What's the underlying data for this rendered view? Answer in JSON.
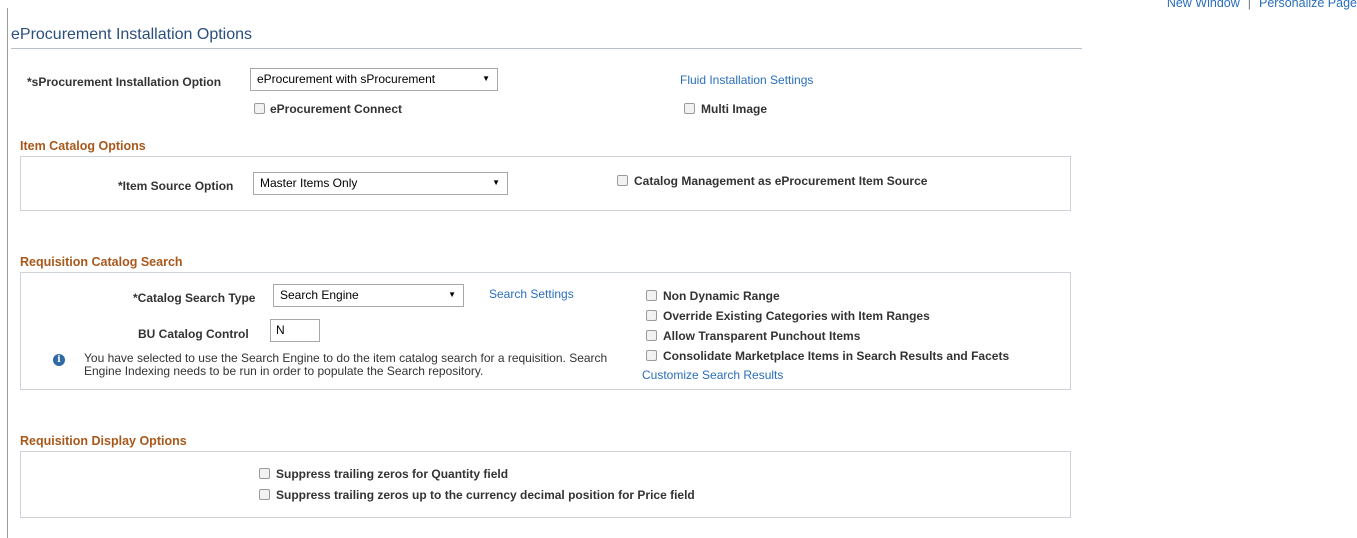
{
  "top_links": {
    "new_window": "New Window",
    "separator": "|",
    "personalize": "Personalize Page"
  },
  "page_title": "eProcurement Installation Options",
  "installation": {
    "option_label": "*sProcurement Installation Option",
    "option_value": "eProcurement with sProcurement",
    "fluid_link": "Fluid Installation Settings",
    "eproc_connect_label": "eProcurement Connect",
    "multi_image_label": "Multi Image"
  },
  "item_catalog": {
    "section_title": "Item Catalog Options",
    "source_label": "*Item Source Option",
    "source_value": "Master Items Only",
    "catalog_mgmt_label": "Catalog Management as eProcurement Item Source"
  },
  "req_catalog_search": {
    "section_title": "Requisition Catalog Search",
    "search_type_label": "*Catalog Search Type",
    "search_type_value": "Search Engine",
    "search_settings_link": "Search Settings",
    "bu_control_label": "BU Catalog Control",
    "bu_control_value": "N",
    "info_icon": "info-icon",
    "info_text": "You have selected to use the Search Engine to do the item catalog search for a requisition. Search Engine Indexing needs to be run in order to populate the Search repository.",
    "checkboxes": [
      "Non Dynamic Range",
      "Override Existing Categories with Item Ranges",
      "Allow Transparent Punchout Items",
      "Consolidate Marketplace Items in Search Results and Facets"
    ],
    "customize_link": "Customize Search Results"
  },
  "req_display": {
    "section_title": "Requisition Display Options",
    "checkboxes": [
      "Suppress trailing zeros for Quantity field",
      "Suppress trailing zeros up to the currency decimal position for Price field"
    ]
  }
}
